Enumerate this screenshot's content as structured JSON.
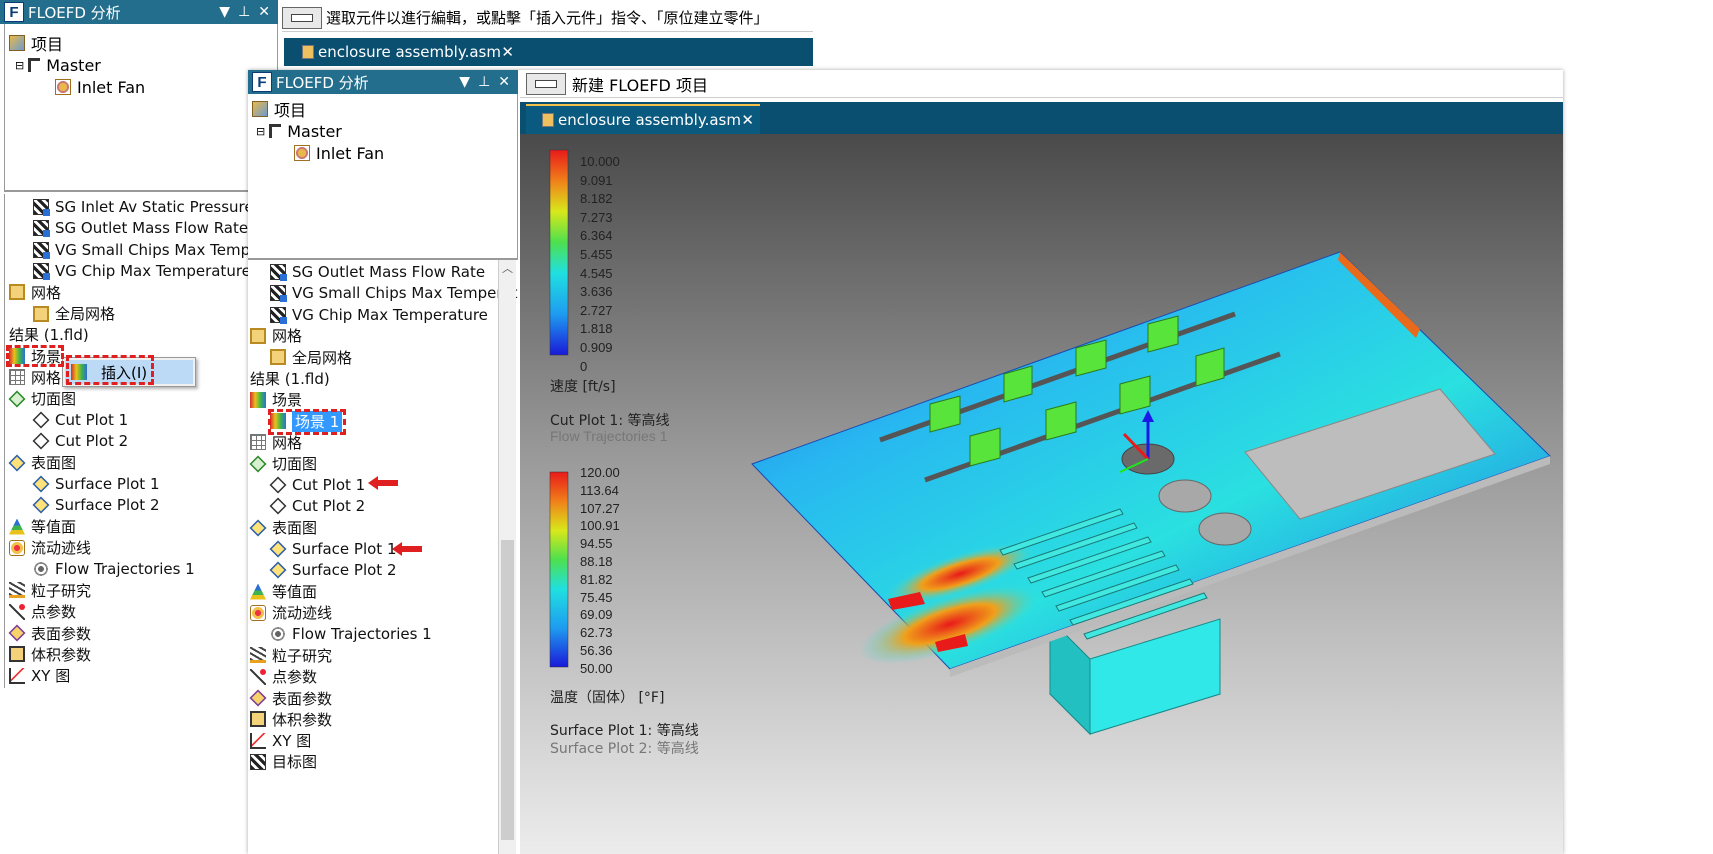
{
  "back_window": {
    "title": "FLOEFD 分析",
    "title_buttons": [
      "▼",
      "⊥",
      "✕"
    ],
    "toolbar_message": "選取元件以進行編輯，或點擊「插入元件」指令、「原位建立零件」",
    "tab_label": "enclosure assembly.asm",
    "project_tree": {
      "root": "项目",
      "master": "Master",
      "fan": "Inlet Fan"
    },
    "items": [
      "SG Inlet Av Static Pressure",
      "SG Outlet Mass Flow Rate",
      "VG Small Chips Max Tempera",
      "VG Chip Max Temperature",
      "网格",
      "全局网格",
      "结果 (1.fld)",
      "场景",
      "网格",
      "切面图",
      "Cut Plot 1",
      "Cut Plot 2",
      "表面图",
      "Surface Plot 1",
      "Surface Plot 2",
      "等值面",
      "流动迹线",
      "Flow Trajectories 1",
      "粒子研究",
      "点参数",
      "表面参数",
      "体积参数",
      "XY 图"
    ],
    "context_menu_item": "插入(I)"
  },
  "front_window": {
    "title": "FLOEFD 分析",
    "title_buttons": [
      "▼",
      "⊥",
      "✕"
    ],
    "toolbar_message": "新建 FLOEFD 项目",
    "tab_label": "enclosure assembly.asm",
    "tab_close": "✕",
    "project_tree": {
      "root": "项目",
      "master": "Master",
      "fan": "Inlet Fan"
    },
    "items": [
      "SG Outlet Mass Flow Rate",
      "VG Small Chips Max Temperat",
      "VG Chip Max Temperature",
      "网格",
      "全局网格",
      "结果 (1.fld)",
      "场景",
      "场景 1",
      "网格",
      "切面图",
      "Cut Plot 1",
      "Cut Plot 2",
      "表面图",
      "Surface Plot 1",
      "Surface Plot 2",
      "等值面",
      "流动迹线",
      "Flow Trajectories 1",
      "粒子研究",
      "点参数",
      "表面参数",
      "体积参数",
      "XY 图",
      "目标图"
    ]
  },
  "viewport": {
    "velocity_ticks": [
      "10.000",
      "9.091",
      "8.182",
      "7.273",
      "6.364",
      "5.455",
      "4.545",
      "3.636",
      "2.727",
      "1.818",
      "0.909",
      "0"
    ],
    "velocity_label": "速度 [ft/s]",
    "velocity_caption": "Cut Plot 1: 等高线",
    "velocity_caption2": "Flow Trajectories 1",
    "temp_ticks": [
      "120.00",
      "113.64",
      "107.27",
      "100.91",
      "94.55",
      "88.18",
      "81.82",
      "75.45",
      "69.09",
      "62.73",
      "56.36",
      "50.00"
    ],
    "temp_label": "温度（固体） [°F]",
    "temp_caption": "Surface Plot 1: 等高线",
    "temp_caption2": "Surface Plot 2: 等高线"
  },
  "colors": {
    "title_bar": "#236e8c",
    "highlight": "#3399ff",
    "annotation": "#e02020"
  }
}
